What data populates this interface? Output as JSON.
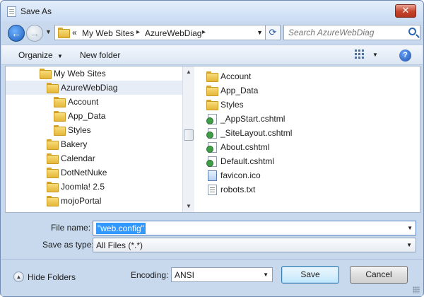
{
  "window": {
    "title": "Save As",
    "close_glyph": "✕"
  },
  "nav": {
    "back_glyph": "←",
    "forward_glyph": "→",
    "history_glyph": "▼",
    "address_prefix": "«",
    "breadcrumbs": [
      "My Web Sites",
      "AzureWebDiag"
    ],
    "crumb_sep": "▸",
    "dropdown_glyph": "▼",
    "refresh_glyph": "⟳",
    "search_placeholder": "Search AzureWebDiag"
  },
  "toolbar": {
    "organize_label": "Organize",
    "organize_caret": "▼",
    "new_folder_label": "New folder",
    "views_caret": "▼",
    "help_glyph": "?"
  },
  "tree": {
    "items": [
      {
        "label": "My Web Sites"
      },
      {
        "label": "AzureWebDiag"
      },
      {
        "label": "Account"
      },
      {
        "label": "App_Data"
      },
      {
        "label": "Styles"
      },
      {
        "label": "Bakery"
      },
      {
        "label": "Calendar"
      },
      {
        "label": "DotNetNuke"
      },
      {
        "label": "Joomla! 2.5"
      },
      {
        "label": "mojoPortal"
      }
    ],
    "scroll_up_glyph": "▲",
    "scroll_down_glyph": "▼"
  },
  "files": {
    "items": [
      {
        "label": "Account",
        "icon": "folder-icon"
      },
      {
        "label": "App_Data",
        "icon": "folder-icon"
      },
      {
        "label": "Styles",
        "icon": "folder-icon"
      },
      {
        "label": "_AppStart.cshtml",
        "icon": "cshtml-file-icon"
      },
      {
        "label": "_SiteLayout.cshtml",
        "icon": "cshtml-file-icon"
      },
      {
        "label": "About.cshtml",
        "icon": "cshtml-file-icon"
      },
      {
        "label": "Default.cshtml",
        "icon": "cshtml-file-icon"
      },
      {
        "label": "favicon.ico",
        "icon": "ico-file-icon"
      },
      {
        "label": "robots.txt",
        "icon": "text-file-icon"
      }
    ]
  },
  "form": {
    "file_name_label": "File name:",
    "file_name_value": "\"web.config\"",
    "save_type_label": "Save as type:",
    "save_type_value": "All Files  (*.*)",
    "dropdown_glyph": "▼"
  },
  "footer": {
    "hide_folders_glyph": "▲",
    "hide_folders_label": "Hide Folders",
    "encoding_label": "Encoding:",
    "encoding_value": "ANSI",
    "save_label": "Save",
    "cancel_label": "Cancel"
  }
}
